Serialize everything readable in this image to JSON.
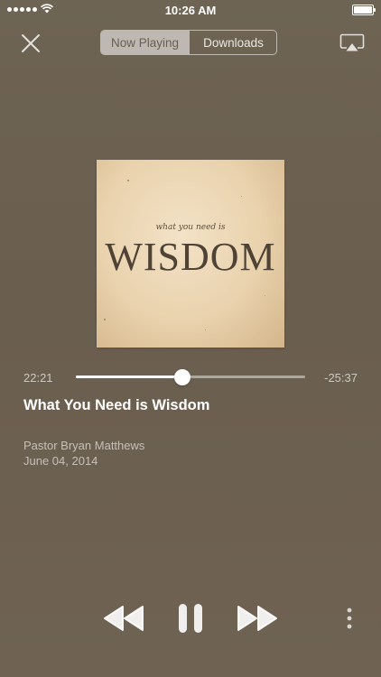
{
  "status_bar": {
    "time": "10:26 AM"
  },
  "header": {
    "tabs": [
      {
        "label": "Now Playing",
        "selected": true
      },
      {
        "label": "Downloads",
        "selected": false
      }
    ]
  },
  "artwork": {
    "small_text": "what you need is",
    "big_text": "WISDOM"
  },
  "player": {
    "elapsed": "22:21",
    "remaining": "-25:37",
    "progress": 0.465
  },
  "track": {
    "title": "What You Need is Wisdom",
    "speaker": "Pastor Bryan Matthews",
    "date": "June 04, 2014"
  },
  "icons": [
    "signal-icon",
    "wifi-icon",
    "battery-icon",
    "close-icon",
    "airplay-icon",
    "rewind-icon",
    "pause-icon",
    "fast-forward-icon",
    "more-icon"
  ],
  "colors": {
    "background": "#6a5e4e",
    "artwork": "#e9d2ad",
    "text_primary": "#ffffff"
  }
}
